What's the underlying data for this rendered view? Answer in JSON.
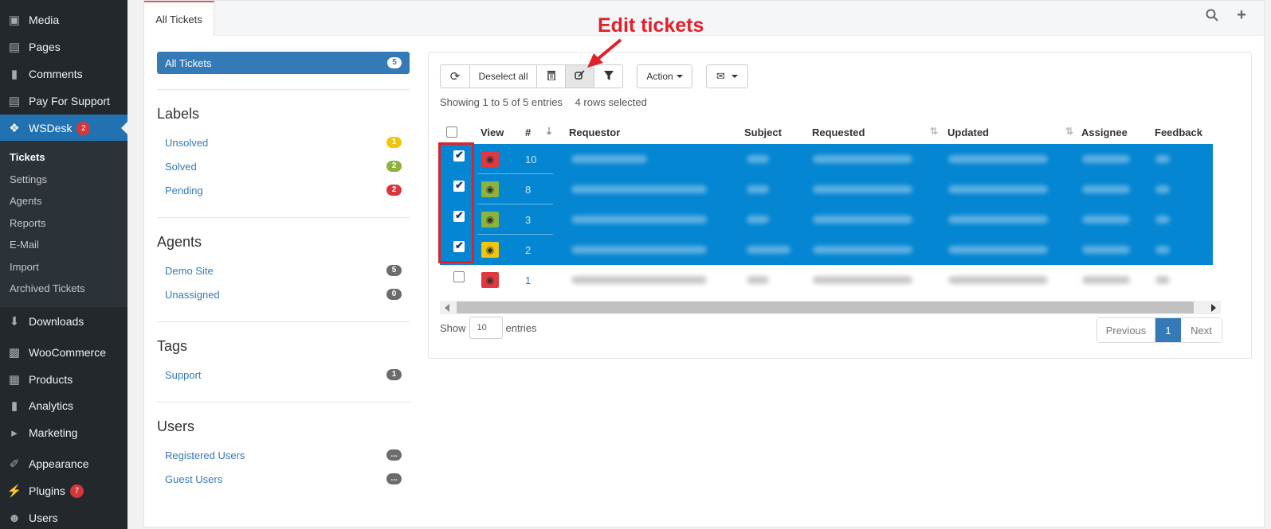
{
  "wp_menu": {
    "media": "Media",
    "pages": "Pages",
    "comments": "Comments",
    "pay_for_support": "Pay For Support",
    "wsdesk": "WSDesk",
    "wsdesk_badge": "2",
    "downloads": "Downloads",
    "woocommerce": "WooCommerce",
    "products": "Products",
    "analytics": "Analytics",
    "marketing": "Marketing",
    "appearance": "Appearance",
    "plugins": "Plugins",
    "plugins_badge": "7",
    "users": "Users"
  },
  "wsdesk_submenu": [
    "Tickets",
    "Settings",
    "Agents",
    "Reports",
    "E-Mail",
    "Import",
    "Archived Tickets"
  ],
  "tab": {
    "label": "All Tickets"
  },
  "filters": {
    "all": {
      "label": "All Tickets",
      "count": "5"
    },
    "labels": {
      "title": "Labels",
      "items": [
        {
          "label": "Unsolved",
          "count": "1",
          "color": "#f1c40f"
        },
        {
          "label": "Solved",
          "count": "2",
          "color": "#8bb33d"
        },
        {
          "label": "Pending",
          "count": "2",
          "color": "#d9363e"
        }
      ]
    },
    "agents": {
      "title": "Agents",
      "items": [
        {
          "label": "Demo Site",
          "count": "5"
        },
        {
          "label": "Unassigned",
          "count": "0"
        }
      ]
    },
    "tags": {
      "title": "Tags",
      "items": [
        {
          "label": "Support",
          "count": "1"
        }
      ]
    },
    "users": {
      "title": "Users",
      "items": [
        {
          "label": "Registered Users",
          "count": "..."
        },
        {
          "label": "Guest Users",
          "count": "..."
        }
      ]
    }
  },
  "toolbar": {
    "deselect_label": "Deselect all",
    "action_label": "Action"
  },
  "table": {
    "info": "Showing 1 to 5 of 5 entries",
    "selected": "4 rows selected",
    "headers": {
      "view": "View",
      "id": "#",
      "requestor": "Requestor",
      "subject": "Subject",
      "requested": "Requested",
      "updated": "Updated",
      "assignee": "Assignee",
      "feedback": "Feedback"
    },
    "rows": [
      {
        "id": "10",
        "selected": true,
        "status_color": "#e0383e"
      },
      {
        "id": "8",
        "selected": true,
        "status_color": "#8bb33d"
      },
      {
        "id": "3",
        "selected": true,
        "status_color": "#8bb33d"
      },
      {
        "id": "2",
        "selected": true,
        "status_color": "#f1c40f"
      },
      {
        "id": "1",
        "selected": false,
        "status_color": "#e0383e"
      }
    ]
  },
  "length": {
    "show": "Show",
    "value": "10",
    "entries": "entries"
  },
  "pagination": {
    "previous": "Previous",
    "current": "1",
    "next": "Next"
  },
  "annotation": {
    "text": "Edit tickets",
    "color": "#e0202a"
  }
}
